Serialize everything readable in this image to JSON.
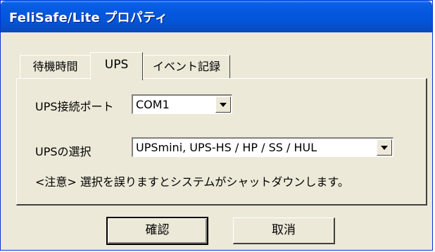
{
  "window": {
    "title": "FeliSafe/Lite プロパティ"
  },
  "tabs": [
    {
      "label": "待機時間"
    },
    {
      "label": "UPS"
    },
    {
      "label": "イベント記録"
    }
  ],
  "ups": {
    "port_label": "UPS接続ポート",
    "port_value": "COM1",
    "select_label": "UPSの選択",
    "select_value": "UPSmini, UPS-HS / HP / SS / HUL",
    "note": "<注意>  選択を誤りますとシステムがシャットダウンします。"
  },
  "buttons": {
    "ok": "確認",
    "cancel": "取消"
  },
  "icons": {
    "dropdown": "chevron-down-icon"
  }
}
